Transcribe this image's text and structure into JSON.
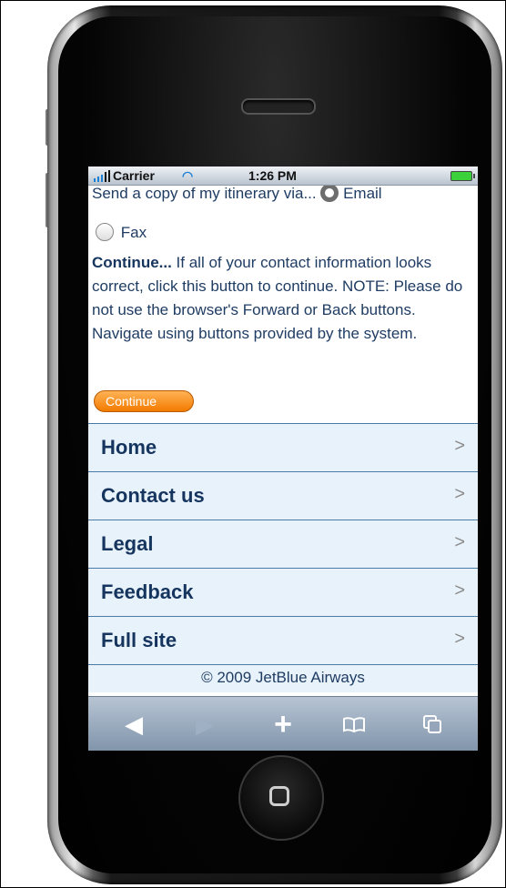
{
  "status_bar": {
    "carrier": "Carrier",
    "time": "1:26 PM"
  },
  "itinerary": {
    "prompt": "Send a copy of my itinerary via...",
    "email_label": "Email",
    "fax_label": "Fax",
    "email_selected": true
  },
  "continue_section": {
    "heading": "Continue...",
    "text": " If all of your contact information looks correct, click this button to continue. NOTE: Please do not use the browser's Forward or Back buttons. Navigate using buttons provided by the system.",
    "button_label": "Continue"
  },
  "nav": {
    "items": [
      {
        "label": "Home"
      },
      {
        "label": "Contact us"
      },
      {
        "label": "Legal"
      },
      {
        "label": "Feedback"
      },
      {
        "label": "Full site"
      }
    ],
    "chevron": ">"
  },
  "footer": {
    "copyright": "© 2009 JetBlue Airways"
  },
  "toolbar": {
    "icons": [
      "back-icon",
      "forward-icon",
      "add-icon",
      "bookmarks-icon",
      "pages-icon"
    ]
  },
  "colors": {
    "accent_orange": "#f37b00",
    "nav_text": "#16355e",
    "nav_bg": "#e8f2fb"
  }
}
